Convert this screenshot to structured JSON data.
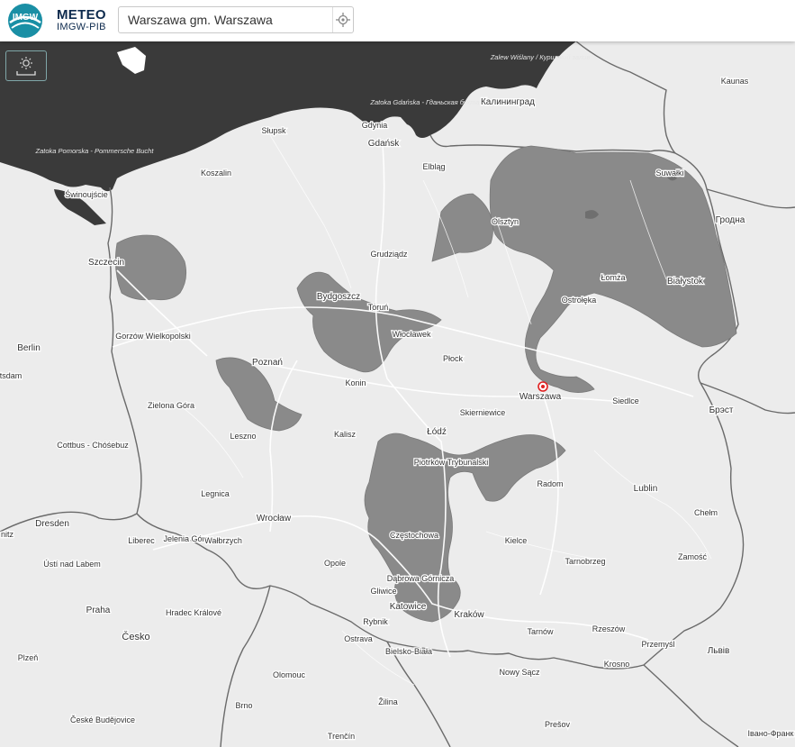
{
  "header": {
    "brand_title": "METEO",
    "brand_sub": "IMGW-PIB",
    "logo_text": "IMGW",
    "search_value": "Warszawa gm. Warszawa"
  },
  "map": {
    "cities": [
      {
        "name": "Gdańsk"
      },
      {
        "name": "Gdynia"
      },
      {
        "name": "Słupsk"
      },
      {
        "name": "Koszalin"
      },
      {
        "name": "Świnoujście"
      },
      {
        "name": "Elbląg"
      },
      {
        "name": "Калининград"
      },
      {
        "name": "Olsztyn"
      },
      {
        "name": "Suwałki"
      },
      {
        "name": "Kaunas"
      },
      {
        "name": "Гродна"
      },
      {
        "name": "Szczecin"
      },
      {
        "name": "Grudziądz"
      },
      {
        "name": "Bydgoszcz"
      },
      {
        "name": "Toruń"
      },
      {
        "name": "Łomża"
      },
      {
        "name": "Białystok"
      },
      {
        "name": "Ostrołęka"
      },
      {
        "name": "Włocławek"
      },
      {
        "name": "Gorzów Wielkopolski"
      },
      {
        "name": "Berlin"
      },
      {
        "name": "Poznań"
      },
      {
        "name": "Płock"
      },
      {
        "name": "Konin"
      },
      {
        "name": "Warszawa"
      },
      {
        "name": "Siedlce"
      },
      {
        "name": "Брэст"
      },
      {
        "name": "Zielona Góra"
      },
      {
        "name": "Skierniewice"
      },
      {
        "name": "Łódź"
      },
      {
        "name": "Leszno"
      },
      {
        "name": "Kalisz"
      },
      {
        "name": "Piotrków Trybunalski"
      },
      {
        "name": "Cottbus - Chóśebuz"
      },
      {
        "name": "Radom"
      },
      {
        "name": "Lublin"
      },
      {
        "name": "Legnica"
      },
      {
        "name": "Chełm"
      },
      {
        "name": "Dresden"
      },
      {
        "name": "Wrocław"
      },
      {
        "name": "Liberec"
      },
      {
        "name": "Jelenia Góra"
      },
      {
        "name": "Wałbrzych"
      },
      {
        "name": "Częstochowa"
      },
      {
        "name": "Kielce"
      },
      {
        "name": "Zamość"
      },
      {
        "name": "Ústí nad Labem"
      },
      {
        "name": "Opole"
      },
      {
        "name": "Tarnobrzeg"
      },
      {
        "name": "Dąbrowa Górnicza"
      },
      {
        "name": "Gliwice"
      },
      {
        "name": "Katowice"
      },
      {
        "name": "Praha"
      },
      {
        "name": "Hradec Králové"
      },
      {
        "name": "Kraków"
      },
      {
        "name": "Rybnik"
      },
      {
        "name": "Rzeszów"
      },
      {
        "name": "Česko"
      },
      {
        "name": "Tarnów"
      },
      {
        "name": "Ostrava"
      },
      {
        "name": "Przemyśl"
      },
      {
        "name": "Львів"
      },
      {
        "name": "Plzeň"
      },
      {
        "name": "Bielsko-Biała"
      },
      {
        "name": "Olomouc"
      },
      {
        "name": "Nowy Sącz"
      },
      {
        "name": "Krosno"
      },
      {
        "name": "Brno"
      },
      {
        "name": "Žilina"
      },
      {
        "name": "České Budějovice"
      },
      {
        "name": "Prešov"
      },
      {
        "name": "Trenčín"
      },
      {
        "name": "Івано-Франк"
      },
      {
        "name": "tsdam"
      },
      {
        "name": "nitz"
      }
    ],
    "sea_labels": [
      {
        "name": "Zatoka Pomorska - Pommersche Bucht"
      },
      {
        "name": "Zatoka Gdańska - Гданьская бухта"
      },
      {
        "name": "Zalew Wiślany / Куршский залив"
      }
    ],
    "colors": {
      "sea": "#3a3a3a",
      "land": "#ececec",
      "warning_area": "#8a8a8a",
      "border": "#6a6a6a",
      "road": "#ffffff",
      "marker": "#e02020"
    },
    "icons": [
      "location-target-icon",
      "layers-icon",
      "map-pin-icon"
    ]
  }
}
